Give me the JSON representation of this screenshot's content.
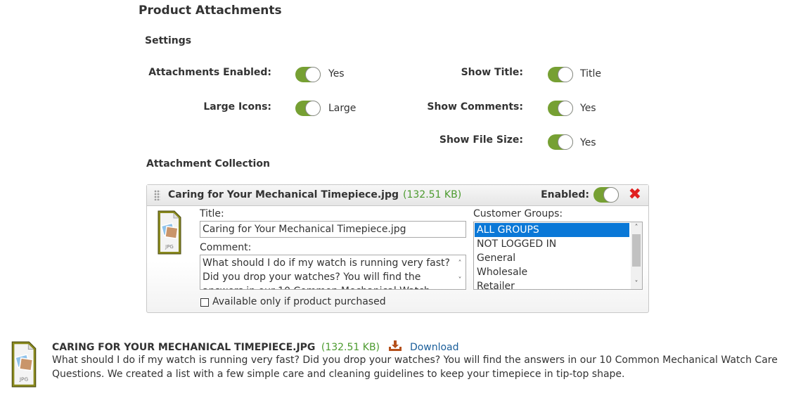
{
  "page": {
    "title": "Product Attachments",
    "settings_heading": "Settings",
    "collection_heading": "Attachment Collection"
  },
  "settings": {
    "attachments_enabled": {
      "label": "Attachments Enabled:",
      "value": "Yes",
      "on": true
    },
    "large_icons": {
      "label": "Large Icons:",
      "value": "Large",
      "on": true
    },
    "show_title": {
      "label": "Show Title:",
      "value": "Title",
      "on": true
    },
    "show_comments": {
      "label": "Show Comments:",
      "value": "Yes",
      "on": true
    },
    "show_file_size": {
      "label": "Show File Size:",
      "value": "Yes",
      "on": true
    }
  },
  "attachment": {
    "filename": "Caring for Your Mechanical Timepiece.jpg",
    "size": "(132.51 KB)",
    "enabled_label": "Enabled:",
    "enabled": true,
    "delete_icon": "close-x-icon",
    "file_type": "JPG",
    "title_label": "Title:",
    "title_value": "Caring for Your Mechanical Timepiece.jpg",
    "comment_label": "Comment:",
    "comment_value": "What should I do if my watch is running very fast? Did you drop your watches? You will find the answers in our 10 Common Mechanical Watch Care Questions. We created a list with a few simple care and cleaning guidelines to keep your timepiece in tip-top shape.",
    "customer_groups_label": "Customer Groups:",
    "customer_groups": [
      "ALL GROUPS",
      "NOT LOGGED IN",
      "General",
      "Wholesale",
      "Retailer"
    ],
    "selected_group": "ALL GROUPS",
    "purchase_only_label": "Available only if product purchased",
    "purchase_only": false
  },
  "preview": {
    "title": "CARING FOR YOUR MECHANICAL TIMEPIECE.JPG",
    "size": "(132.51 KB)",
    "download_icon": "download-icon",
    "download_label": "Download",
    "file_type": "JPG",
    "description": "What should I do if my watch is running very fast? Did you drop your watches? You will find the answers in our 10 Common Mechanical Watch Care Questions. We created a list with a few simple care and cleaning guidelines to keep your timepiece in tip-top shape."
  },
  "colors": {
    "toggle_on": "#76a033",
    "file_size": "#4b9a2e",
    "selection": "#0a78d7",
    "delete": "#e02020",
    "download_icon": "#b5501b",
    "link": "#1a5e9a"
  }
}
